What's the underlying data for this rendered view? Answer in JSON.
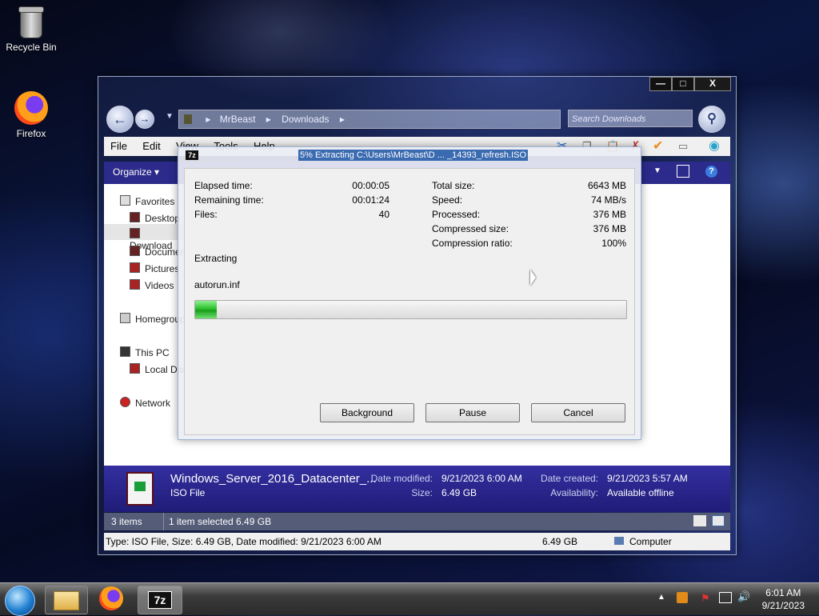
{
  "desktop": {
    "icons": [
      {
        "label": "Recycle Bin",
        "icon": "recycle-bin-icon"
      },
      {
        "label": "Firefox",
        "icon": "firefox-icon"
      }
    ]
  },
  "explorer": {
    "controls": {
      "minimize": "—",
      "maximize": "□",
      "close": "X"
    },
    "address": {
      "segments": [
        "MrBeast",
        "Downloads"
      ]
    },
    "search_placeholder": "Search Downloads",
    "menu": [
      "File",
      "Edit",
      "View",
      "Tools",
      "Help"
    ],
    "organize": "Organize",
    "nav": {
      "favorites": "Favorites",
      "desktop": "Desktop",
      "downloads": "Download",
      "documents": "Document",
      "pictures": "Pictures",
      "videos": "Videos",
      "homegroup": "Homegroup",
      "thispc": "This PC",
      "localdisk": "Local Disk",
      "network": "Network"
    },
    "details": {
      "filename": "Windows_Server_2016_Datacenter_...",
      "filetype": "ISO File",
      "date_modified_label": "Date modified:",
      "date_modified": "9/21/2023 6:00 AM",
      "size_label": "Size:",
      "size": "6.49 GB",
      "date_created_label": "Date created:",
      "date_created": "9/21/2023 5:57 AM",
      "availability_label": "Availability:",
      "availability": "Available offline"
    },
    "status": {
      "items": "3 items",
      "selected": "1 item selected  6.49 GB",
      "info": "Type: ISO File, Size: 6.49 GB, Date modified: 9/21/2023 6:00 AM",
      "size": "6.49 GB",
      "location": "Computer"
    }
  },
  "dialog": {
    "title": "5% Extracting C:\\Users\\MrBeast\\D ... _14393_refresh.ISO",
    "icon_label": "7z",
    "elapsed_label": "Elapsed time:",
    "elapsed": "00:00:05",
    "remaining_label": "Remaining time:",
    "remaining": "00:01:24",
    "files_label": "Files:",
    "files": "40",
    "total_size_label": "Total size:",
    "total_size": "6643 MB",
    "speed_label": "Speed:",
    "speed": "74 MB/s",
    "processed_label": "Processed:",
    "processed": "376 MB",
    "compressed_label": "Compressed size:",
    "compressed": "376 MB",
    "ratio_label": "Compression ratio:",
    "ratio": "100%",
    "status": "Extracting",
    "current_file": "autorun.inf",
    "progress": 0.05,
    "buttons": {
      "background": "Background",
      "pause": "Pause",
      "cancel": "Cancel"
    }
  },
  "taskbar": {
    "pinned": [
      "file-explorer-icon",
      "firefox-icon",
      "7zip-icon"
    ],
    "seven_zip_label": "7z",
    "time": "6:01 AM",
    "date": "9/21/2023"
  }
}
